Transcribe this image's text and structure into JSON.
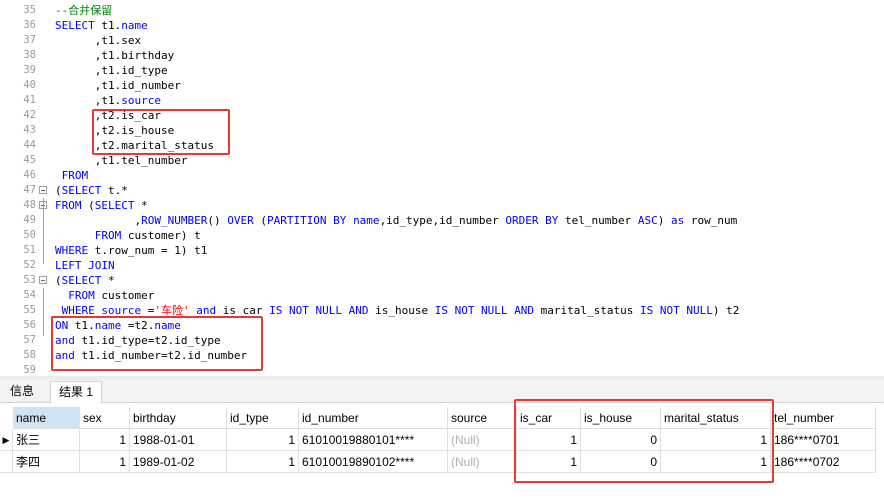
{
  "editor": {
    "lines": [
      {
        "n": "35",
        "html": "<span class='cm'>--合并保留</span>"
      },
      {
        "n": "36",
        "html": "<span class='kw'>SELECT</span> t1.<span class='kw'>name</span>"
      },
      {
        "n": "37",
        "html": "      ,t1.sex"
      },
      {
        "n": "38",
        "html": "      ,t1.birthday"
      },
      {
        "n": "39",
        "html": "      ,t1.id_type"
      },
      {
        "n": "40",
        "html": "      ,t1.id_number"
      },
      {
        "n": "41",
        "html": "      ,t1.<span class='kw'>source</span>"
      },
      {
        "n": "42",
        "html": "      ,t2.is_car"
      },
      {
        "n": "43",
        "html": "      ,t2.is_house"
      },
      {
        "n": "44",
        "html": "      ,t2.marital_status"
      },
      {
        "n": "45",
        "html": "      ,t1.tel_number"
      },
      {
        "n": "46",
        "html": " <span class='kw'>FROM</span>"
      },
      {
        "n": "47",
        "html": "(<span class='kw'>SELECT</span> t.*",
        "fold": true
      },
      {
        "n": "48",
        "html": "<span class='kw'>FROM</span> (<span class='kw'>SELECT</span> *",
        "fold": true
      },
      {
        "n": "49",
        "html": "            ,<span class='fn'>ROW_NUMBER</span>() <span class='kw'>OVER</span> (<span class='kw'>PARTITION BY</span> <span class='kw'>name</span>,id_type,id_number <span class='kw'>ORDER BY</span> tel_number <span class='kw'>ASC</span>) <span class='kw'>as</span> row_num"
      },
      {
        "n": "50",
        "html": "      <span class='kw'>FROM</span> customer) t"
      },
      {
        "n": "51",
        "html": "<span class='kw'>WHERE</span> t.row_num = 1) t1"
      },
      {
        "n": "52",
        "html": "<span class='kw'>LEFT JOIN</span>"
      },
      {
        "n": "53",
        "html": "(<span class='kw'>SELECT</span> *",
        "fold": true
      },
      {
        "n": "54",
        "html": "  <span class='kw'>FROM</span> customer"
      },
      {
        "n": "55",
        "html": " <span class='kw'>WHERE</span> <span class='kw'>source</span> =<span class='str'>'车险'</span> <span class='kw'>and</span> is_car <span class='kw'>IS NOT NULL</span> <span class='kw'>AND</span> is_house <span class='kw'>IS NOT NULL</span> <span class='kw'>AND</span> marital_status <span class='kw'>IS NOT NULL</span>) t2"
      },
      {
        "n": "56",
        "html": "<span class='kw'>ON</span> t1.<span class='kw'>name</span> =t2.<span class='kw'>name</span>"
      },
      {
        "n": "57",
        "html": "<span class='kw'>and</span> t1.id_type=t2.id_type"
      },
      {
        "n": "58",
        "html": "<span class='kw'>and</span> t1.id_number=t2.id_number"
      },
      {
        "n": "59",
        "html": ""
      }
    ]
  },
  "tabs": {
    "info": "信息",
    "result": "结果 1"
  },
  "grid": {
    "columns": [
      "name",
      "sex",
      "birthday",
      "id_type",
      "id_number",
      "source",
      "is_car",
      "is_house",
      "marital_status",
      "tel_number"
    ],
    "rows": [
      [
        "张三",
        "1",
        "1988-01-01",
        "1",
        "61010019880101****",
        "(Null)",
        "1",
        "0",
        "1",
        "186****0701"
      ],
      [
        "李四",
        "1",
        "1989-01-02",
        "1",
        "61010019890102****",
        "(Null)",
        "1",
        "0",
        "1",
        "186****0702"
      ]
    ]
  }
}
